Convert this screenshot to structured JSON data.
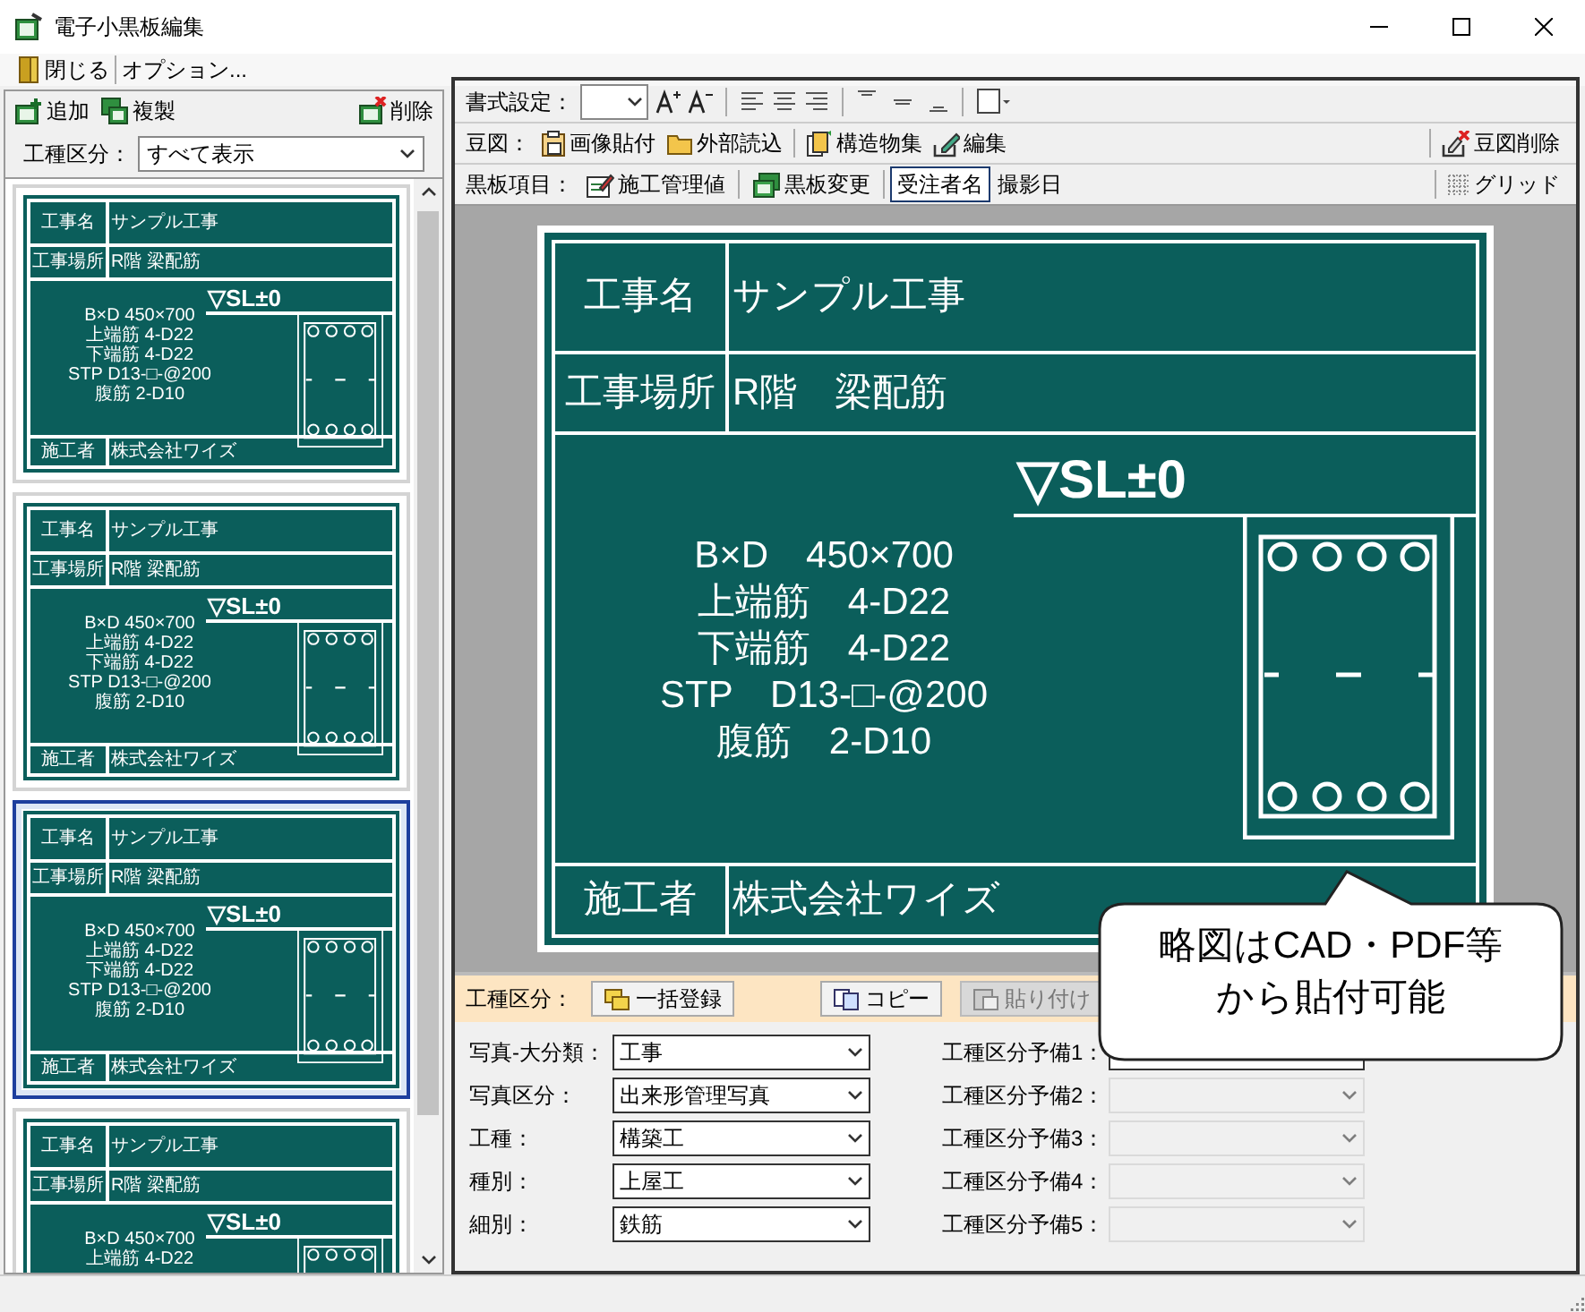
{
  "window": {
    "title": "電子小黒板編集"
  },
  "menu": [
    {
      "label": "閉じる"
    },
    {
      "label": "オプション..."
    }
  ],
  "list_toolbar": {
    "left": [
      {
        "label": "追加"
      },
      {
        "label": "複製"
      }
    ],
    "right": [
      {
        "label": "削除"
      }
    ]
  },
  "list_filter": {
    "label": "工種区分：",
    "value": "すべて表示"
  },
  "boards": [
    {
      "selected": false,
      "board": {
        "rows": [
          {
            "label": "工事名",
            "value": "サンプル工事"
          },
          {
            "label": "工事場所",
            "value": "R階 梁配筋"
          }
        ],
        "level_mark": "▽SL±0",
        "lines": [
          "B×D 450×700",
          "上端筋 4-D22",
          "下端筋 4-D22",
          "STP D13-□-@200",
          "腹筋 2-D10"
        ],
        "footer": {
          "label": "施工者",
          "value": "株式会社ワイズ"
        }
      }
    },
    {
      "selected": false,
      "board": {
        "rows": [
          {
            "label": "工事名",
            "value": "サンプル工事"
          },
          {
            "label": "工事場所",
            "value": "R階 梁配筋"
          }
        ],
        "level_mark": "▽SL±0",
        "lines": [
          "B×D 450×700",
          "上端筋 4-D22",
          "下端筋 4-D22",
          "STP D13-□-@200",
          "腹筋 2-D10"
        ],
        "footer": {
          "label": "施工者",
          "value": "株式会社ワイズ"
        }
      }
    },
    {
      "selected": true,
      "board": {
        "rows": [
          {
            "label": "工事名",
            "value": "サンプル工事"
          },
          {
            "label": "工事場所",
            "value": "R階 梁配筋"
          }
        ],
        "level_mark": "▽SL±0",
        "lines": [
          "B×D 450×700",
          "上端筋 4-D22",
          "下端筋 4-D22",
          "STP D13-□-@200",
          "腹筋 2-D10"
        ],
        "footer": {
          "label": "施工者",
          "value": "株式会社ワイズ"
        }
      }
    },
    {
      "selected": false,
      "board": {
        "rows": [
          {
            "label": "工事名",
            "value": "サンプル工事"
          },
          {
            "label": "工事場所",
            "value": "R階 梁配筋"
          }
        ],
        "level_mark": "▽SL±0",
        "lines": [
          "B×D 450×700",
          "上端筋 4-D22"
        ]
      }
    }
  ],
  "format_toolbar": {
    "label": "書式設定："
  },
  "figure_toolbar": {
    "label": "豆図：",
    "groups": [
      [
        {
          "label": "画像貼付"
        },
        {
          "label": "外部読込"
        }
      ],
      [
        {
          "label": "構造物集"
        },
        {
          "label": "編集"
        }
      ]
    ],
    "right": [
      {
        "label": "豆図削除"
      }
    ]
  },
  "item_toolbar": {
    "label": "黒板項目：",
    "groups": [
      [
        {
          "label": "施工管理値",
          "selected": false
        }
      ],
      [
        {
          "label": "黒板変更",
          "selected": false
        }
      ],
      [
        {
          "label": "受注者名",
          "selected": true
        },
        {
          "label": "撮影日",
          "selected": false
        }
      ]
    ],
    "right": [
      {
        "label": "グリッド"
      }
    ]
  },
  "blackboard": {
    "rows": [
      {
        "label": "工事名",
        "value": "サンプル工事"
      },
      {
        "label": "工事場所",
        "value": "R階　梁配筋"
      }
    ],
    "level_mark": "▽SL±0",
    "lines": [
      "B×D　450×700",
      "上端筋　4-D22",
      "下端筋　4-D22",
      "STP　D13-□-@200",
      "腹筋　2-D10"
    ],
    "footer": {
      "label": "施工者",
      "value": "株式会社ワイズ"
    }
  },
  "callout": {
    "lines": [
      "略図はCAD・PDF等",
      "から貼付可能"
    ]
  },
  "classification_bar": {
    "label": "工種区分：",
    "buttons": [
      {
        "label": "一括登録",
        "disabled": false
      },
      {
        "label": "コピー",
        "disabled": false
      },
      {
        "label": "貼り付け",
        "disabled": true
      }
    ]
  },
  "classification_fields": [
    {
      "label": "写真-大分類：",
      "value": "工事"
    },
    {
      "label": "写真区分：",
      "value": "出来形管理写真"
    },
    {
      "label": "工種：",
      "value": "構築工"
    },
    {
      "label": "種別：",
      "value": "上屋工"
    },
    {
      "label": "細別：",
      "value": "鉄筋"
    }
  ],
  "spare_fields": [
    {
      "label": "工種区分予備1：",
      "disabled": false
    },
    {
      "label": "工種区分予備2：",
      "disabled": true
    },
    {
      "label": "工種区分予備3：",
      "disabled": true
    },
    {
      "label": "工種区分予備4：",
      "disabled": true
    },
    {
      "label": "工種区分予備5：",
      "disabled": true
    }
  ]
}
